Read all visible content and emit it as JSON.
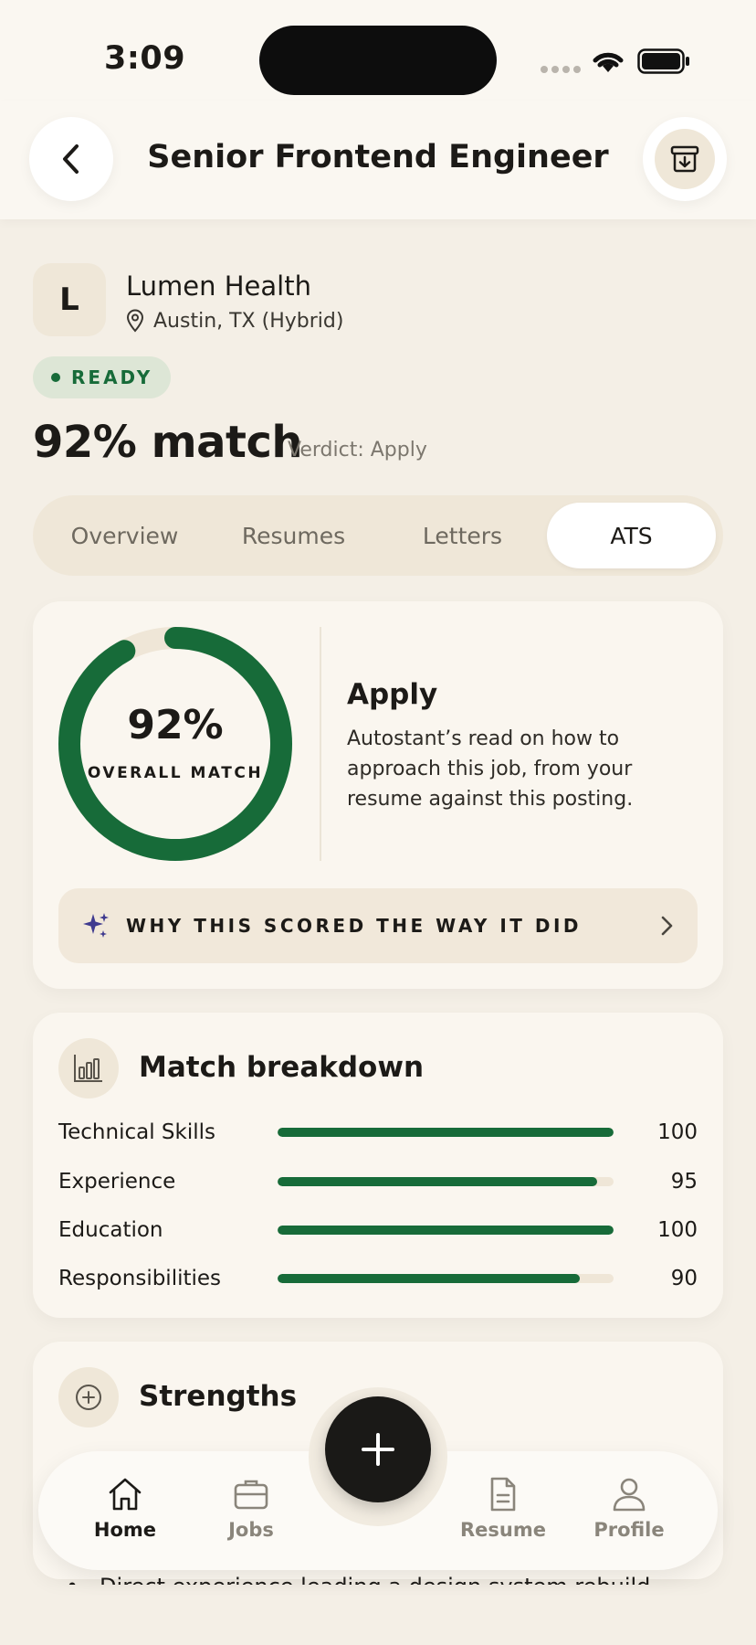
{
  "status_bar": {
    "time": "3:09"
  },
  "header": {
    "title": "Senior Frontend Engineer"
  },
  "company": {
    "initial": "L",
    "name": "Lumen Health",
    "location": "Austin, TX (Hybrid)"
  },
  "status_badge": "READY",
  "match": {
    "title": "92% match",
    "verdict": "Verdict: Apply"
  },
  "tabs": [
    {
      "label": "Overview",
      "active": false
    },
    {
      "label": "Resumes",
      "active": false
    },
    {
      "label": "Letters",
      "active": false
    },
    {
      "label": "ATS",
      "active": true
    }
  ],
  "score_card": {
    "percent": 92,
    "percent_label": "92%",
    "ring_label": "OVERALL MATCH",
    "verdict_title": "Apply",
    "description": "Autostant’s read on how to approach this job, from your resume against this posting.",
    "why_label": "WHY THIS SCORED THE WAY IT DID"
  },
  "breakdown": {
    "title": "Match breakdown",
    "rows": [
      {
        "label": "Technical Skills",
        "value": 100,
        "value_text": "100"
      },
      {
        "label": "Experience",
        "value": 95,
        "value_text": "95"
      },
      {
        "label": "Education",
        "value": 100,
        "value_text": "100"
      },
      {
        "label": "Responsibilities",
        "value": 90,
        "value_text": "90"
      }
    ]
  },
  "strengths": {
    "title": "Strengths",
    "first_item": "Direct experience leading a design system rebuild"
  },
  "nav": {
    "items": [
      {
        "label": "Home",
        "icon": "home-icon",
        "active": true
      },
      {
        "label": "Jobs",
        "icon": "briefcase-icon",
        "active": false
      },
      {
        "label": "Resume",
        "icon": "document-icon",
        "active": false
      },
      {
        "label": "Profile",
        "icon": "user-icon",
        "active": false
      }
    ]
  },
  "colors": {
    "accent_green": "#176b39",
    "background": "#f4efe6",
    "card": "#faf6ef",
    "sparkle": "#3f3a8f"
  }
}
